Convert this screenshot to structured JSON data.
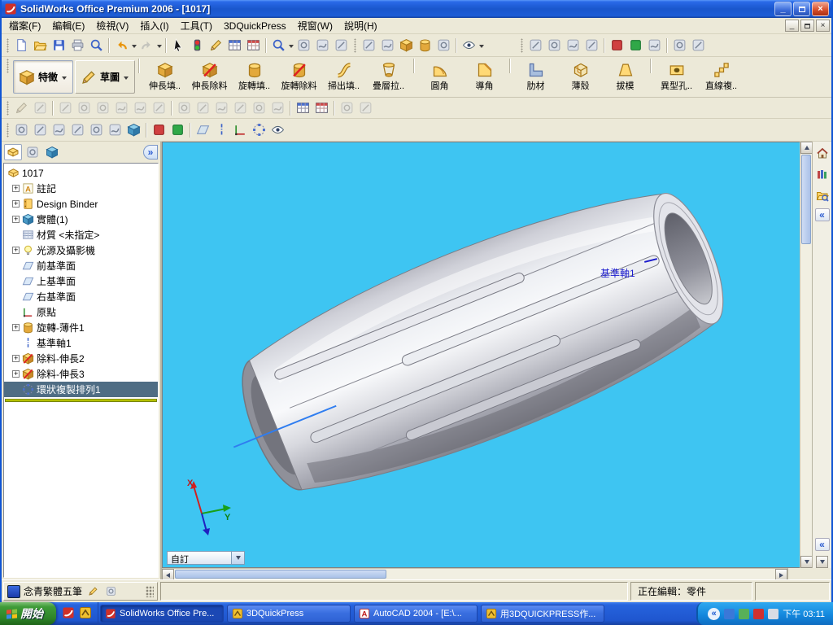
{
  "window": {
    "title": "SolidWorks Office Premium 2006 - [1017]"
  },
  "menu": {
    "items": [
      "檔案(F)",
      "編輯(E)",
      "檢視(V)",
      "插入(I)",
      "工具(T)",
      "3DQuickPress",
      "視窗(W)",
      "說明(H)"
    ]
  },
  "feature_bar": {
    "modes": [
      "特徵",
      "草圖"
    ],
    "tools": [
      "伸長填..",
      "伸長除料",
      "旋轉填..",
      "旋轉除料",
      "掃出填..",
      "疊層拉..",
      "圓角",
      "導角",
      "肋材",
      "薄殼",
      "拔模",
      "異型孔..",
      "直線複.."
    ]
  },
  "tree": {
    "root": "1017",
    "items": [
      "註記",
      "Design Binder",
      "實體(1)",
      "材質 <未指定>",
      "光源及攝影機",
      "前基準面",
      "上基準面",
      "右基準面",
      "原點",
      "旋轉-薄件1",
      "基準軸1",
      "除料-伸長2",
      "除料-伸長3",
      "環狀複製排列1"
    ]
  },
  "viewport": {
    "annotation": "基準軸1",
    "view_combo": "自訂",
    "triad_x": "X",
    "triad_y": "Y"
  },
  "statusbar": {
    "editing": "正在編輯：零件"
  },
  "ime": {
    "name": "念青繁體五筆"
  },
  "taskbar": {
    "start": "開始",
    "tasks": [
      "SolidWorks Office Pre...",
      "3DQuickPress",
      "AutoCAD 2004 - [E:\\...",
      "用3DQUICKPRESS作..."
    ],
    "clock": "下午 03:11"
  },
  "colors": {
    "viewport_bg": "#3ec5f2",
    "taskbar_blue": "#245edb",
    "title_blue": "#1c5ad0",
    "tree_selection": "#4f6d84",
    "rollback_bar": "#b9c900"
  }
}
